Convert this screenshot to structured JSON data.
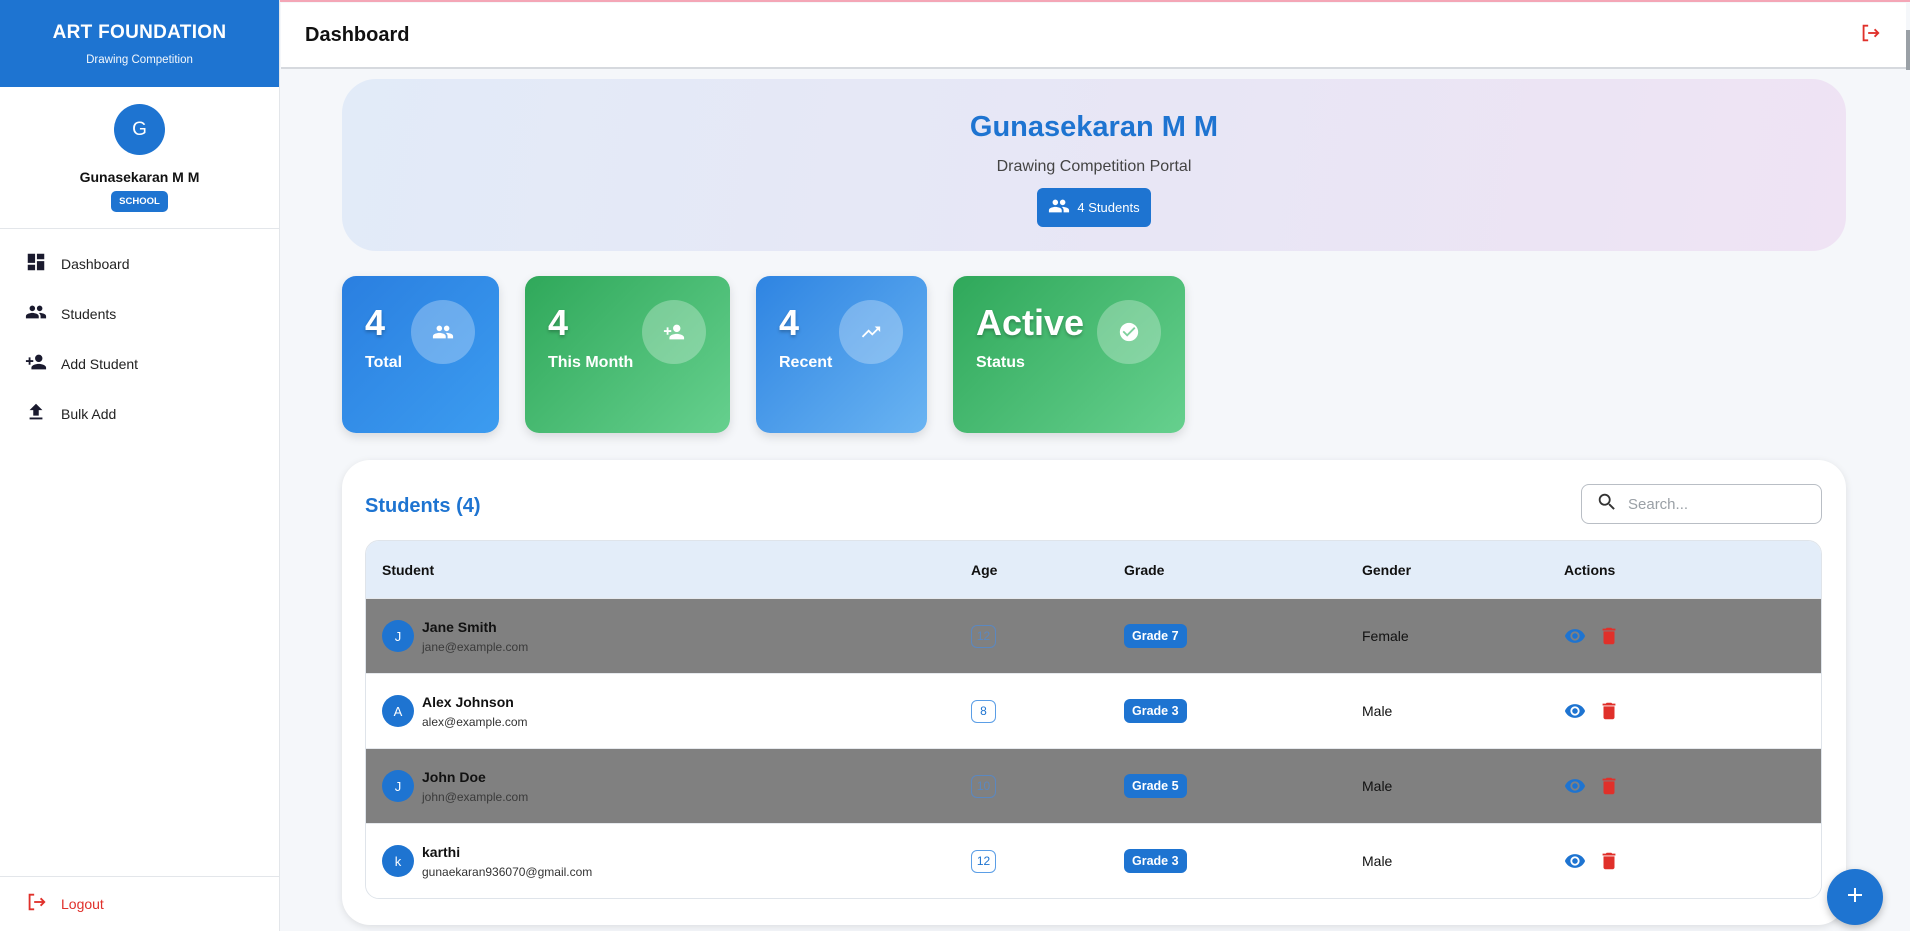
{
  "brand": {
    "title": "ART FOUNDATION",
    "subtitle": "Drawing Competition"
  },
  "profile": {
    "initial": "G",
    "name": "Gunasekaran M M",
    "role": "SCHOOL"
  },
  "nav": [
    {
      "label": "Dashboard",
      "icon": "dashboard-icon"
    },
    {
      "label": "Students",
      "icon": "people-icon"
    },
    {
      "label": "Add Student",
      "icon": "person-add-icon"
    },
    {
      "label": "Bulk Add",
      "icon": "upload-icon"
    }
  ],
  "logout_label": "Logout",
  "header": {
    "title": "Dashboard"
  },
  "hero": {
    "name": "Gunasekaran M M",
    "subtitle": "Drawing Competition Portal",
    "badge": "4 Students"
  },
  "stats": [
    {
      "value": "4",
      "label": "Total",
      "icon": "people-icon"
    },
    {
      "value": "4",
      "label": "This Month",
      "icon": "person-add-icon"
    },
    {
      "value": "4",
      "label": "Recent",
      "icon": "trending-up-icon"
    },
    {
      "value": "Active",
      "label": "Status",
      "icon": "check-circle-icon"
    }
  ],
  "students_panel": {
    "title": "Students (4)",
    "search_placeholder": "Search...",
    "columns": [
      "Student",
      "Age",
      "Grade",
      "Gender",
      "Actions"
    ],
    "rows": [
      {
        "initial": "J",
        "name": "Jane Smith",
        "email": "jane@example.com",
        "age": "12",
        "grade": "Grade 7",
        "gender": "Female"
      },
      {
        "initial": "A",
        "name": "Alex Johnson",
        "email": "alex@example.com",
        "age": "8",
        "grade": "Grade 3",
        "gender": "Male"
      },
      {
        "initial": "J",
        "name": "John Doe",
        "email": "john@example.com",
        "age": "10",
        "grade": "Grade 5",
        "gender": "Male"
      },
      {
        "initial": "k",
        "name": "karthi",
        "email": "gunaekaran936070@gmail.com",
        "age": "12",
        "grade": "Grade 3",
        "gender": "Male"
      }
    ]
  },
  "colors": {
    "primary": "#1e74d1",
    "danger": "#e0302a",
    "success": "#2fa85a"
  }
}
